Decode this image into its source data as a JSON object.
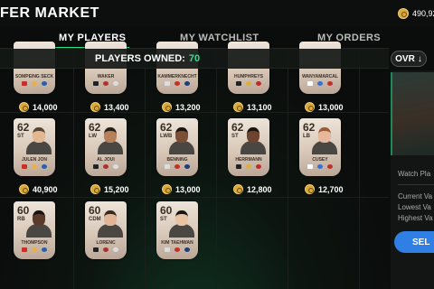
{
  "header": {
    "title": "FER MARKET",
    "coins": "490,92"
  },
  "tabs": [
    {
      "label": "MY PLAYERS",
      "active": true
    },
    {
      "label": "MY WATCHLIST",
      "active": false
    },
    {
      "label": "MY ORDERS",
      "active": false
    }
  ],
  "owned": {
    "label": "PLAYERS OWNED:",
    "count": "70"
  },
  "sort": {
    "label": "OVR",
    "direction_icon": "arrow-down-icon"
  },
  "partial_row": [
    {
      "name": "SOMPEING SECK",
      "price": "14,000"
    },
    {
      "name": "WAKER",
      "price": "13,400"
    },
    {
      "name": "KAMMERKNECHT",
      "price": "13,200"
    },
    {
      "name": "HUMPHREYS",
      "price": "13,100"
    },
    {
      "name": "WANYAMARCAL",
      "price": "13,000"
    }
  ],
  "row2": [
    {
      "rating": "62",
      "position": "ST",
      "name": "JULEN JON",
      "price": "40,900",
      "skin": "#e2b893",
      "hair": "#5a4630"
    },
    {
      "rating": "62",
      "position": "LW",
      "name": "AL JOUI",
      "price": "15,200",
      "skin": "#b5805a",
      "hair": "#2a1f18"
    },
    {
      "rating": "62",
      "position": "LWB",
      "name": "BENNING",
      "price": "13,000",
      "skin": "#7a4f36",
      "hair": "#1b1410"
    },
    {
      "rating": "62",
      "position": "ST",
      "name": "HERRMANN",
      "price": "12,800",
      "skin": "#6e4430",
      "hair": "#1d1410"
    },
    {
      "rating": "62",
      "position": "LB",
      "name": "CUSEY",
      "price": "12,700",
      "skin": "#e6b79a",
      "hair": "#9c5a36"
    }
  ],
  "row3": [
    {
      "rating": "60",
      "position": "RB",
      "name": "THOMPSON",
      "skin": "#5b3a2a",
      "hair": "#1a1210"
    },
    {
      "rating": "60",
      "position": "CDM",
      "name": "LORENC",
      "skin": "#e1b596",
      "hair": "#3b2a1e"
    },
    {
      "rating": "60",
      "position": "ST",
      "name": "KIM TAEHWAN",
      "skin": "#e8c3a3",
      "hair": "#1a1512"
    }
  ],
  "side": {
    "watch_label": "Watch Pla",
    "current_label": "Current Va",
    "lowest_label": "Lowest Va",
    "highest_label": "Highest Va",
    "sell_label": "SEL"
  },
  "colors": {
    "accent": "#2fe08b",
    "coin": "#d9a83b",
    "sell": "#2f7fe4"
  }
}
